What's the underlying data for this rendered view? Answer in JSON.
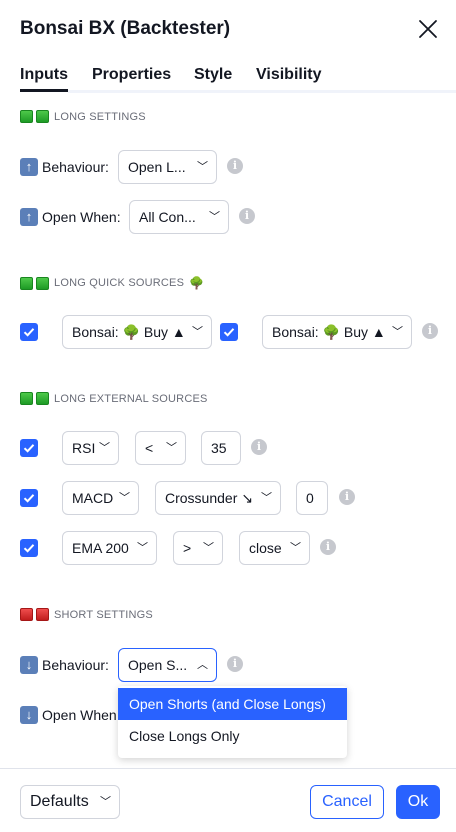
{
  "dialog": {
    "title": "Bonsai BX (Backtester)"
  },
  "tabs": [
    {
      "label": "Inputs",
      "active": true
    },
    {
      "label": "Properties"
    },
    {
      "label": "Style"
    },
    {
      "label": "Visibility"
    }
  ],
  "long_settings": {
    "header": "LONG SETTINGS",
    "behaviour": {
      "label": "Behaviour:",
      "value": "Open L..."
    },
    "open_when": {
      "label": "Open When:",
      "value": "All Con..."
    }
  },
  "long_quick_sources": {
    "header": "LONG QUICK SOURCES",
    "header_emoji": "🌳",
    "source_1": {
      "checked": true,
      "value": "Bonsai: 🌳 Buy ▲"
    },
    "source_2": {
      "checked": true,
      "value": "Bonsai: 🌳 Buy ▲"
    }
  },
  "long_external_sources": {
    "header": "LONG EXTERNAL SOURCES",
    "rows": [
      {
        "checked": true,
        "source": "RSI",
        "operator": "<",
        "value": "35"
      },
      {
        "checked": true,
        "source": "MACD",
        "operator": "Crossunder ↘",
        "value": "0"
      },
      {
        "checked": true,
        "source": "EMA 200",
        "operator": ">",
        "value": "close"
      }
    ]
  },
  "short_settings": {
    "header": "SHORT SETTINGS",
    "behaviour": {
      "label": "Behaviour:",
      "value": "Open S..."
    },
    "open_when": {
      "label": "Open When"
    }
  },
  "dropdown": {
    "options": [
      {
        "label": "Open Shorts (and Close Longs)",
        "selected": true
      },
      {
        "label": "Close Longs Only"
      }
    ]
  },
  "footer": {
    "defaults_label": "Defaults",
    "cancel_label": "Cancel",
    "ok_label": "Ok"
  },
  "colors": {
    "accent": "#2962ff",
    "long_marker": "#1e9b25",
    "short_marker": "#c11d1d",
    "info_icon": "#c6c8ce"
  },
  "icons": {
    "close": "close-icon",
    "long_arrow": "arrow-up-icon",
    "short_arrow": "arrow-down-icon",
    "info": "info-icon",
    "chevron": "chevron-down-icon"
  }
}
